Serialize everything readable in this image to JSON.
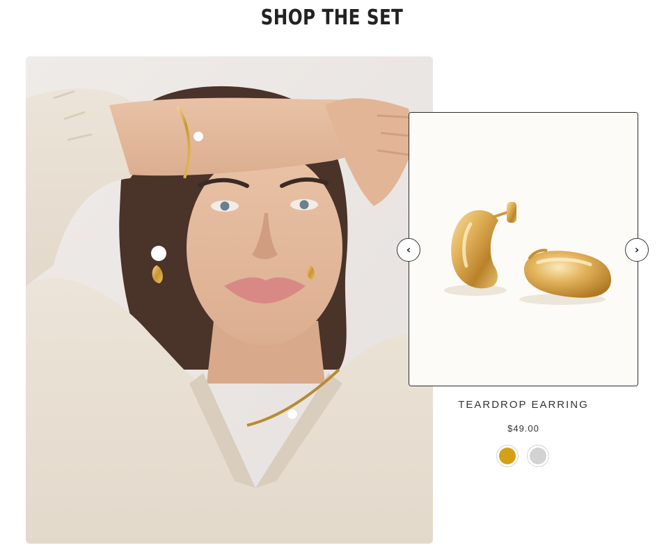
{
  "section": {
    "title": "SHOP THE SET"
  },
  "lookbook": {
    "hotspots": [
      {
        "item": "bracelet"
      },
      {
        "item": "earring"
      },
      {
        "item": "necklace"
      }
    ]
  },
  "product": {
    "name": "TEARDROP EARRING",
    "price": "$49.00",
    "swatches": [
      {
        "name": "gold",
        "color": "#d4a017"
      },
      {
        "name": "silver",
        "color": "#d2d2d2"
      }
    ]
  },
  "carousel": {
    "prev_icon": "chevron-left-icon",
    "next_icon": "chevron-right-icon",
    "prev_glyph": "‹",
    "next_glyph": "›"
  }
}
